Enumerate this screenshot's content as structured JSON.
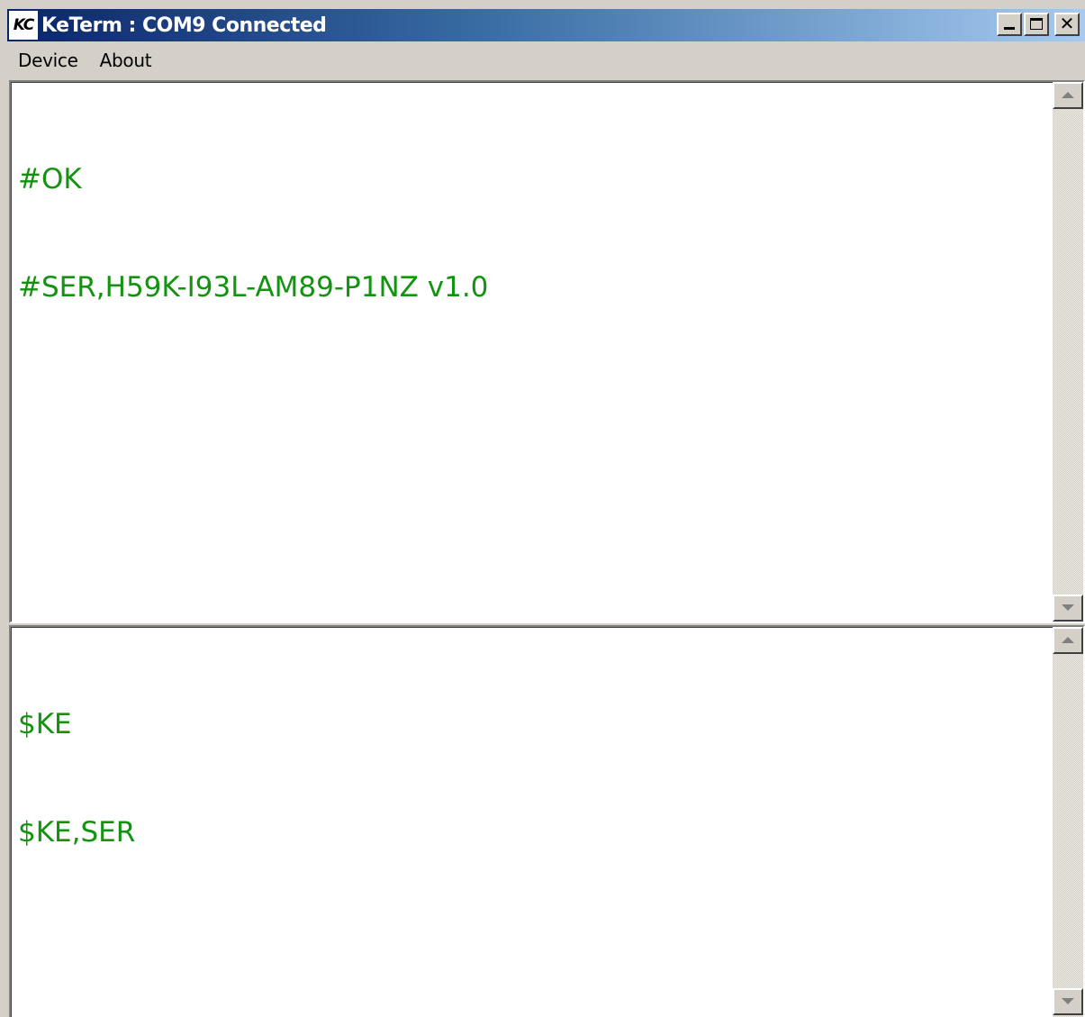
{
  "window": {
    "title": "KeTerm : COM9 Connected",
    "icon_text": "KC",
    "icon": "keterm-app-icon",
    "controls": {
      "minimize": "minimize-icon",
      "maximize": "maximize-icon",
      "close": "close-icon",
      "close_glyph": "✕"
    }
  },
  "menu": {
    "items": [
      {
        "label": "Device"
      },
      {
        "label": "About"
      }
    ]
  },
  "output_pane": {
    "lines": [
      "#OK",
      "#SER,H59K-I93L-AM89-P1NZ v1.0"
    ]
  },
  "input_pane": {
    "lines": [
      "$KE",
      "$KE,SER"
    ]
  },
  "colors": {
    "terminal_text": "#13930f",
    "titlebar_start": "#0a246a",
    "titlebar_end": "#a6caf0",
    "window_face": "#d4d0c8"
  }
}
